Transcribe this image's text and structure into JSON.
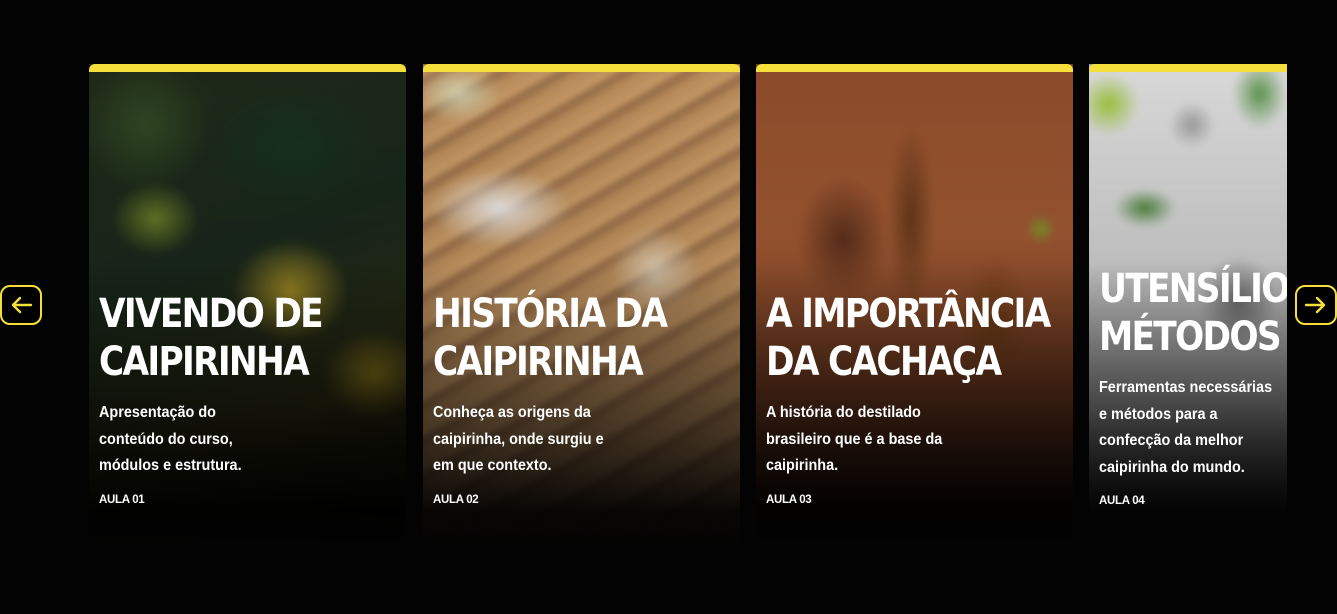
{
  "colors": {
    "accent": "#f5df3a",
    "background": "#030303"
  },
  "navigation": {
    "prev_icon": "arrow-left-icon",
    "next_icon": "arrow-right-icon"
  },
  "cards": [
    {
      "title_lines": [
        "VIVENDO DE",
        "CAIPIRINHA"
      ],
      "description_lines": [
        "Apresentação do",
        "conteúdo do curso,",
        "módulos e estrutura."
      ],
      "lesson": "AULA 01"
    },
    {
      "title_lines": [
        "HISTÓRIA DA",
        "CAIPIRINHA"
      ],
      "description_lines": [
        "Conheça as origens da",
        "caipirinha, onde surgiu e",
        "em que contexto."
      ],
      "lesson": "AULA 02"
    },
    {
      "title_lines": [
        "A IMPORTÂNCIA",
        "DA CACHAÇA"
      ],
      "description_lines": [
        "A história do destilado",
        "brasileiro que é a base da",
        "caipirinha."
      ],
      "lesson": "AULA 03"
    },
    {
      "title_lines": [
        "UTENSÍLIOS",
        "MÉTODOS"
      ],
      "description_lines": [
        "Ferramentas necessárias",
        "e métodos para a",
        "confecção da melhor",
        "caipirinha do mundo."
      ],
      "lesson": "AULA 04"
    }
  ]
}
